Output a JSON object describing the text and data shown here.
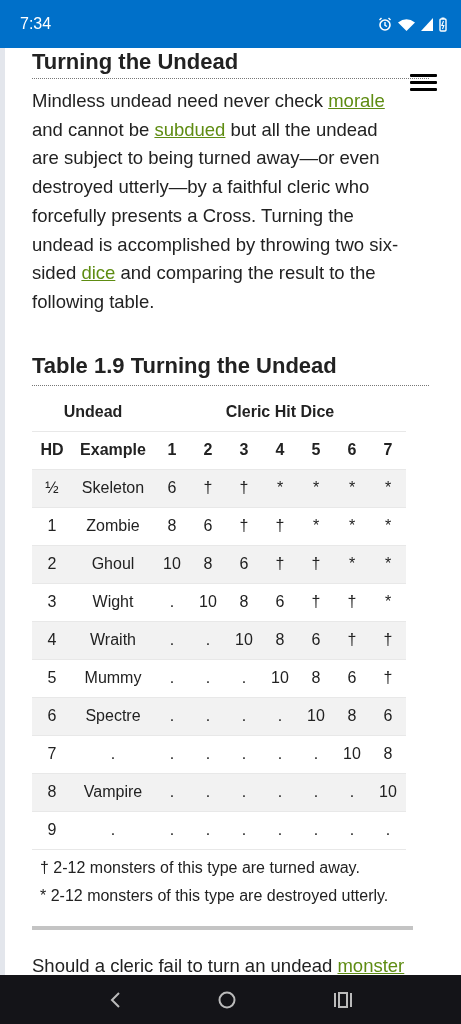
{
  "status_bar": {
    "time": "7:34"
  },
  "article": {
    "heading": "Turning the Undead",
    "paragraph": [
      {
        "text": "Mindless undead need never check ",
        "link": false
      },
      {
        "text": "morale",
        "link": true
      },
      {
        "text": " and cannot be ",
        "link": false
      },
      {
        "text": "subdued",
        "link": true
      },
      {
        "text": " but all the undead are subject to being turned away—or even destroyed utterly—by a faithful cleric who forcefully presents a Cross. Turning the undead is accomplished by throwing two six-sided ",
        "link": false
      },
      {
        "text": "dice",
        "link": true
      },
      {
        "text": " and comparing the result to the following table.",
        "link": false
      }
    ]
  },
  "table": {
    "title": "Table 1.9 Turning the Undead",
    "group_headers": [
      "Undead",
      "Cleric Hit Dice"
    ],
    "columns": [
      "HD",
      "Example",
      "1",
      "2",
      "3",
      "4",
      "5",
      "6",
      "7"
    ],
    "rows": [
      [
        "½",
        "Skeleton",
        "6",
        "†",
        "†",
        "*",
        "*",
        "*",
        "*"
      ],
      [
        "1",
        "Zombie",
        "8",
        "6",
        "†",
        "†",
        "*",
        "*",
        "*"
      ],
      [
        "2",
        "Ghoul",
        "10",
        "8",
        "6",
        "†",
        "†",
        "*",
        "*"
      ],
      [
        "3",
        "Wight",
        ".",
        "10",
        "8",
        "6",
        "†",
        "†",
        "*"
      ],
      [
        "4",
        "Wraith",
        ".",
        ".",
        "10",
        "8",
        "6",
        "†",
        "†"
      ],
      [
        "5",
        "Mummy",
        ".",
        ".",
        ".",
        "10",
        "8",
        "6",
        "†"
      ],
      [
        "6",
        "Spectre",
        ".",
        ".",
        ".",
        ".",
        "10",
        "8",
        "6"
      ],
      [
        "7",
        ".",
        ".",
        ".",
        ".",
        ".",
        ".",
        "10",
        "8"
      ],
      [
        "8",
        "Vampire",
        ".",
        ".",
        ".",
        ".",
        ".",
        ".",
        "10"
      ],
      [
        "9",
        ".",
        ".",
        ".",
        ".",
        ".",
        ".",
        ".",
        "."
      ]
    ],
    "footnotes": [
      "† 2-12 monsters of this type are turned away.",
      "* 2-12 monsters of this type are destroyed utterly."
    ]
  },
  "next_paragraph": [
    {
      "text": "Should a cleric fail to turn an undead ",
      "link": false
    },
    {
      "text": "monster",
      "link": true
    }
  ]
}
